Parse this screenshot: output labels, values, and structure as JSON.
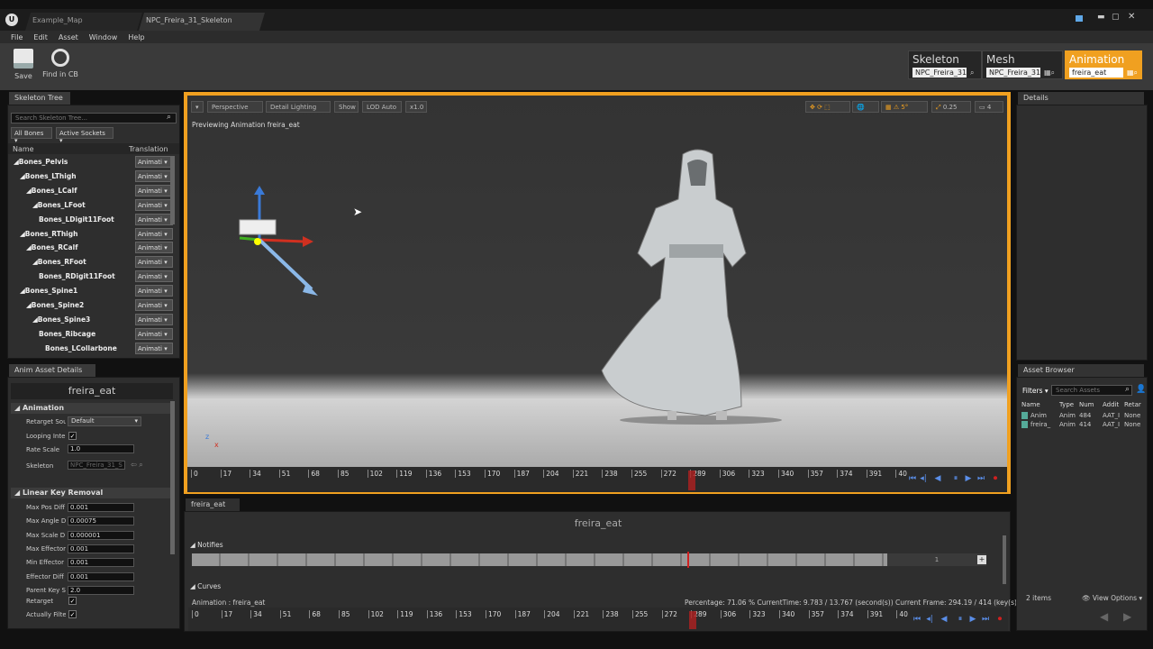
{
  "tabs": [
    {
      "label": "Example_Map"
    },
    {
      "label": "NPC_Freira_31_Skeleton"
    }
  ],
  "menu": [
    "File",
    "Edit",
    "Asset",
    "Window",
    "Help"
  ],
  "toolbar": {
    "save": "Save",
    "find": "Find in CB"
  },
  "modes": [
    {
      "title": "Skeleton",
      "value": "NPC_Freira_31"
    },
    {
      "title": "Mesh",
      "value": "NPC_Freira_31"
    },
    {
      "title": "Animation",
      "value": "freira_eat"
    }
  ],
  "skeleton_tree": {
    "tab": "Skeleton Tree",
    "search_placeholder": "Search Skeleton Tree...",
    "filter_bones": "All Bones",
    "filter_sockets": "Active Sockets",
    "col_name": "Name",
    "col_translation": "Translation",
    "anim_label": "Animati",
    "bones": [
      "Bones_Pelvis",
      "Bones_LThigh",
      "Bones_LCalf",
      "Bones_LFoot",
      "Bones_LDigit11Foot",
      "Bones_RThigh",
      "Bones_RCalf",
      "Bones_RFoot",
      "Bones_RDigit11Foot",
      "Bones_Spine1",
      "Bones_Spine2",
      "Bones_Spine3",
      "Bones_Ribcage",
      "Bones_LCollarbone"
    ]
  },
  "asset_details": {
    "tab": "Anim Asset Details",
    "asset_name": "freira_eat",
    "section_animation": "Animation",
    "retarget_label": "Retarget Sou",
    "retarget_value": "Default",
    "looping_label": "Looping Inter",
    "rate_label": "Rate Scale",
    "rate_value": "1.0",
    "skeleton_label": "Skeleton",
    "skeleton_value": "NPC_Freira_31_S",
    "section_lkr": "Linear Key Removal",
    "props": [
      {
        "label": "Max Pos Diff",
        "value": "0.001"
      },
      {
        "label": "Max Angle D",
        "value": "0.00075"
      },
      {
        "label": "Max Scale D",
        "value": "0.000001"
      },
      {
        "label": "Max Effector",
        "value": "0.001"
      },
      {
        "label": "Min Effector",
        "value": "0.001"
      },
      {
        "label": "Effector Diff",
        "value": "0.001"
      },
      {
        "label": "Parent Key S",
        "value": "2.0"
      }
    ],
    "retarget2_label": "Retarget",
    "filter_label": "Actually Filte"
  },
  "viewport": {
    "perspective": "Perspective",
    "lighting": "Detail Lighting",
    "show": "Show",
    "lod": "LOD Auto",
    "speed": "x1.0",
    "preview_text": "Previewing Animation freira_eat",
    "cam_speed": "0.25",
    "cam_num": "4",
    "ticks": [
      "0",
      "17",
      "34",
      "51",
      "68",
      "85",
      "102",
      "119",
      "136",
      "153",
      "170",
      "187",
      "204",
      "221",
      "238",
      "255",
      "272",
      "289",
      "306",
      "323",
      "340",
      "357",
      "374",
      "391",
      "40"
    ]
  },
  "sequence": {
    "tab": "freira_eat",
    "title": "freira_eat",
    "notifies": "Notifies",
    "notify_track": "1",
    "curves": "Curves",
    "anim_label": "Animation : freira_eat",
    "status": "Percentage: 71.06 % CurrentTime: 9.783 / 13.767 (second(s)) Current Frame: 294.19 / 414 (key(s))"
  },
  "details": {
    "tab": "Details"
  },
  "asset_browser": {
    "tab": "Asset Browser",
    "filters": "Filters",
    "search_placeholder": "Search Assets",
    "cols": [
      "Name",
      "Type",
      "Num",
      "Addit",
      "Retar"
    ],
    "rows": [
      {
        "name": "Anim",
        "type": "Anim",
        "num": "484",
        "addit": "AAT_I",
        "retar": "None"
      },
      {
        "name": "freira_",
        "type": "Anim",
        "num": "414",
        "addit": "AAT_I",
        "retar": "None"
      }
    ],
    "count": "2 items",
    "view_options": "View Options"
  },
  "colors": {
    "accent": "#f0a020",
    "playback": "#5a8ee8",
    "record": "#d02020"
  }
}
